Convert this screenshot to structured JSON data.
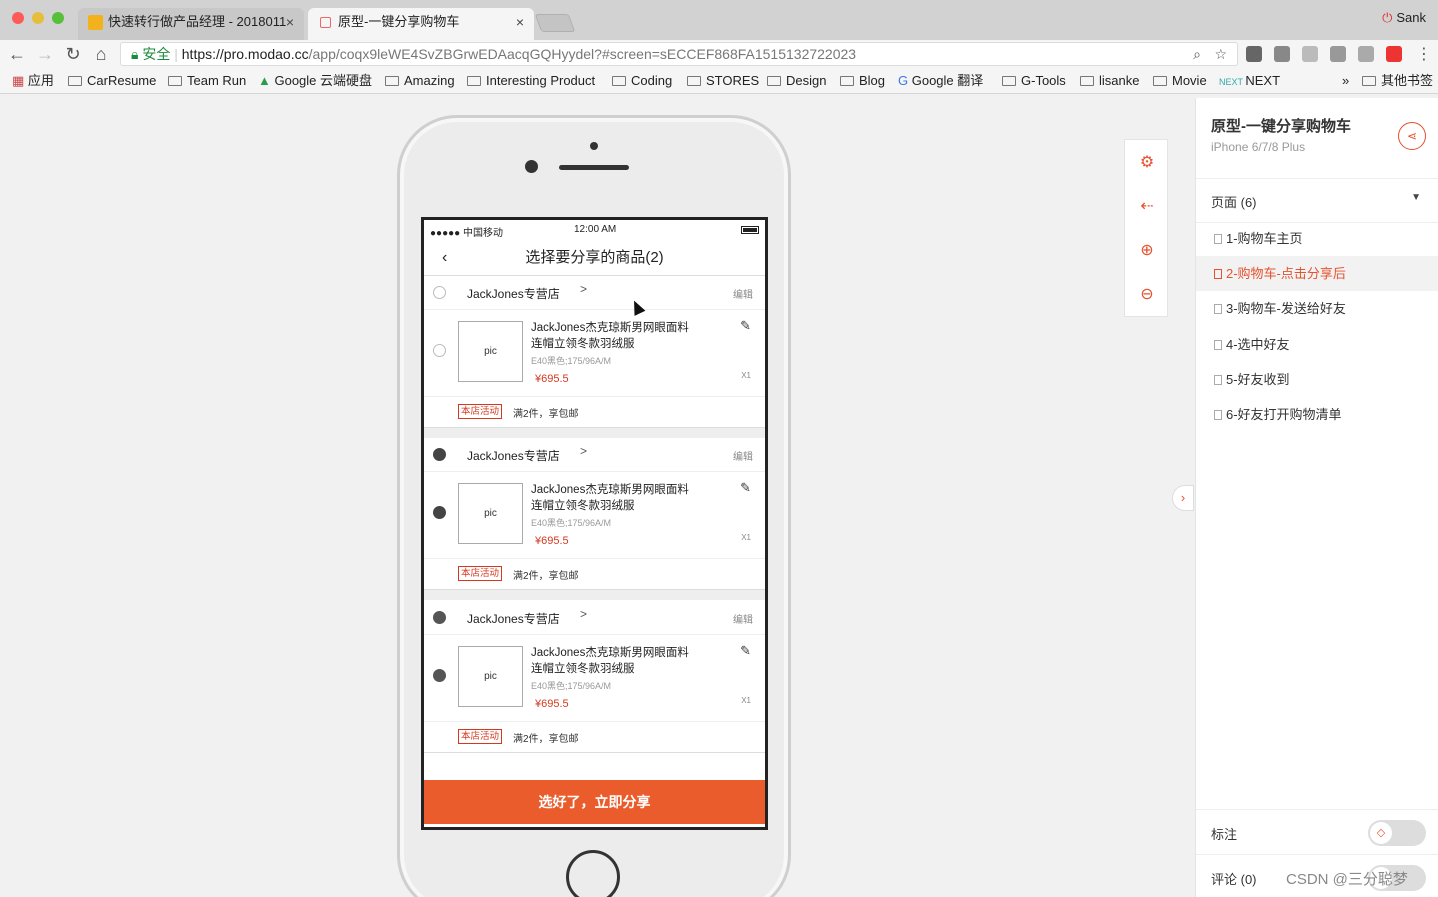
{
  "browser": {
    "tabs": [
      {
        "title": "快速转行做产品经理 - 2018011",
        "close": "×"
      },
      {
        "title": "原型-一键分享购物车",
        "close": "×"
      }
    ],
    "profile": "Sank",
    "url": {
      "secure_label": "安全",
      "host": "https://pro.modao.cc",
      "path": "/app/coqx9leWE4SvZBGrwEDAacqGQHyydel?#screen=sECCEF868FA1515132722023"
    },
    "bookmarks": [
      "应用",
      "CarResume",
      "Team Run",
      "Google 云端硬盘",
      "Amazing",
      "Interesting Product",
      "Coding",
      "STORES",
      "Design",
      "Blog",
      "Google 翻译",
      "G-Tools",
      "lisanke",
      "Movie",
      "NEXT"
    ],
    "more_bookmarks": "»",
    "other_bookmarks": "其他书签"
  },
  "phone": {
    "status": {
      "carrier": "●●●●● 中国移动",
      "time": "12:00 AM"
    },
    "nav_title": "选择要分享的商品(2)",
    "back": "‹",
    "stores": [
      {
        "name": "JackJones专营店",
        "arrow": ">",
        "edit": "编辑",
        "pic": "pic",
        "product_line1": "JackJones杰克琼斯男网眼面料",
        "product_line2": "连帽立领冬款羽绒服",
        "spec": "E40黑色;175/96A/M",
        "price": "¥695.5",
        "qty": "X1",
        "promo_tag": "本店活动",
        "promo_text": "满2件，享包邮"
      },
      {
        "name": "JackJones专营店",
        "arrow": ">",
        "edit": "编辑",
        "pic": "pic",
        "product_line1": "JackJones杰克琼斯男网眼面料",
        "product_line2": "连帽立领冬款羽绒服",
        "spec": "E40黑色;175/96A/M",
        "price": "¥695.5",
        "qty": "X1",
        "promo_tag": "本店活动",
        "promo_text": "满2件，享包邮"
      },
      {
        "name": "JackJones专营店",
        "arrow": ">",
        "edit": "编辑",
        "pic": "pic",
        "product_line1": "JackJones杰克琼斯男网眼面料",
        "product_line2": "连帽立领冬款羽绒服",
        "spec": "E40黑色;175/96A/M",
        "price": "¥695.5",
        "qty": "X1",
        "promo_tag": "本店活动",
        "promo_text": "满2件，享包邮"
      }
    ],
    "share_button": "选好了，立即分享"
  },
  "panel": {
    "title": "原型-一键分享购物车",
    "device": "iPhone 6/7/8 Plus",
    "pages_label": "页面 (6)",
    "pages": [
      "1-购物车主页",
      "2-购物车-点击分享后",
      "3-购物车-发送给好友",
      "4-选中好友",
      "5-好友收到",
      "6-好友打开购物清单"
    ],
    "annotation_label": "标注",
    "comments_label": "评论 (0)"
  },
  "watermark": "CSDN @三分聪梦",
  "colors": {
    "accent": "#e6512f",
    "share_button": "#ea5c2c",
    "price": "#d4381e"
  }
}
